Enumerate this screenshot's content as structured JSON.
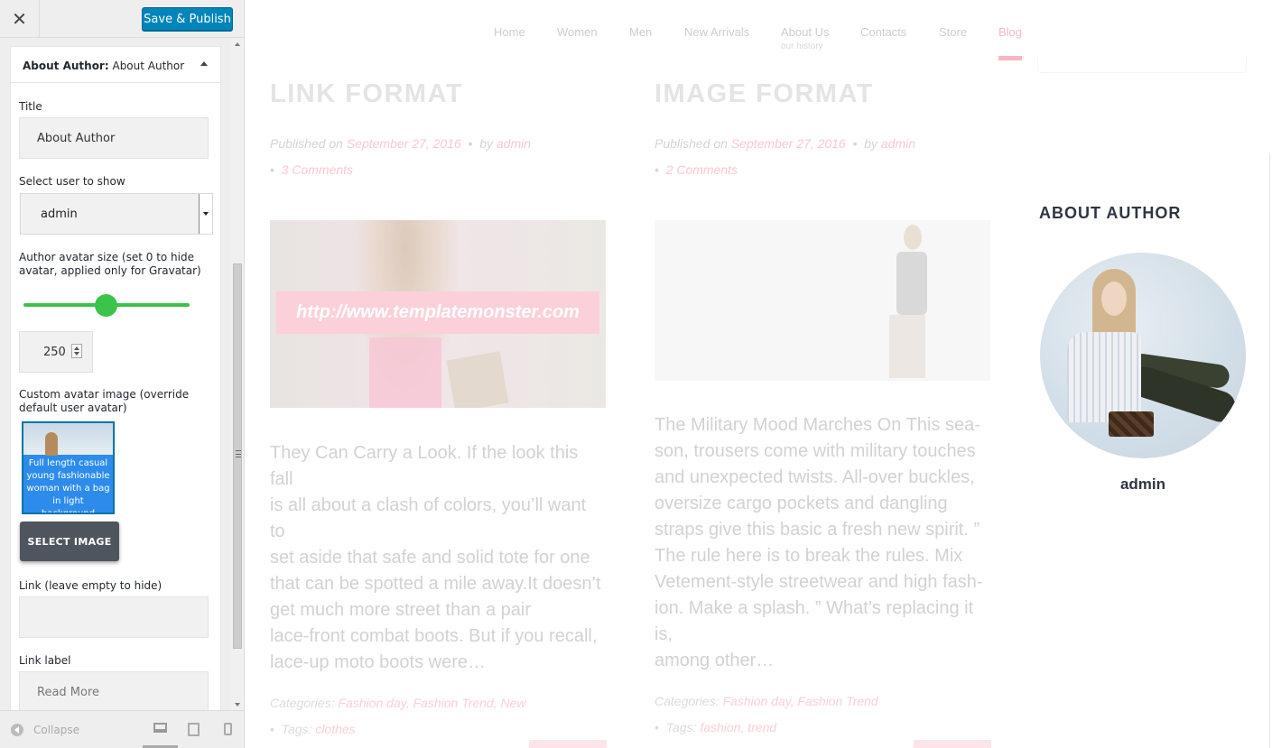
{
  "customizer": {
    "close_icon": "close-icon",
    "save_label": "Save & Publish",
    "widget": {
      "prefix": "About Author:",
      "name": "About Author",
      "fields": {
        "title_label": "Title",
        "title_value": "About Author",
        "user_label": "Select user to show",
        "user_value": "admin",
        "avatar_size_label": "Author avatar size (set 0 to hide avatar, applied only for Gravatar)",
        "avatar_size_value": "250",
        "custom_avatar_label": "Custom avatar image (override default user avatar)",
        "avatar_caption": "Full length casual young fashionable woman with a bag in light background",
        "select_image_label": "SELECT IMAGE",
        "link_label": "Link (leave empty to hide)",
        "link_value": "",
        "link_text_label": "Link label",
        "link_text_placeholder": "Read More"
      }
    },
    "footer": {
      "collapse_label": "Collapse",
      "devices": [
        "desktop-icon",
        "tablet-icon",
        "mobile-icon"
      ]
    },
    "accent_color": "#0085ba",
    "slider_color": "#3bc34a"
  },
  "site": {
    "nav": [
      {
        "label": "Home",
        "sub": ""
      },
      {
        "label": "Women",
        "sub": ""
      },
      {
        "label": "Men",
        "sub": ""
      },
      {
        "label": "New Arrivals",
        "sub": ""
      },
      {
        "label": "About Us",
        "sub": "our history"
      },
      {
        "label": "Contacts",
        "sub": ""
      },
      {
        "label": "Store",
        "sub": ""
      },
      {
        "label": "Blog",
        "sub": "",
        "active": true
      }
    ],
    "posts": [
      {
        "title": "LINK FORMAT",
        "published_prefix": "Published on",
        "date": "September 27, 2016",
        "by": "by",
        "author": "admin",
        "comments": "3 Comments",
        "image_link": "http://www.templatemonster.com",
        "excerpt": [
          "They Can Carry a Look. If the look this fall",
          "is all about a clash of colors, you’ll want to",
          "set aside that safe and solid tote for one",
          "that can be spotted a mile away.It doesn’t",
          "get much more street than a pair",
          "lace-front combat boots. But if you recall,",
          "lace-up moto boots were…"
        ],
        "categories_label": "Categories:",
        "categories": "Fashion day, Fashion Trend, New",
        "tags_label": "Tags:",
        "tags": "clothes"
      },
      {
        "title": "IMAGE FORMAT",
        "published_prefix": "Published on",
        "date": "September 27, 2016",
        "by": "by",
        "author": "admin",
        "comments": "2 Comments",
        "excerpt": [
          "The Military Mood Marches On This sea-",
          "son, trousers come with military touches",
          "and unexpected twists. All-over buckles,",
          "oversize cargo pockets and dangling",
          "straps give this basic a fresh new spirit. ”",
          "The rule here is to break the rules. Mix",
          "Vetement-style streetwear and high fash-",
          "ion. Make a splash. ” What’s replacing it is,",
          "among other…"
        ],
        "categories_label": "Categories:",
        "categories": "Fashion day, Fashion Trend",
        "tags_label": "Tags:",
        "tags": "fashion, trend"
      }
    ],
    "sidebar_widget": {
      "title": "ABOUT AUTHOR",
      "author_name": "admin"
    },
    "accent_color": "#f5b7c2"
  }
}
